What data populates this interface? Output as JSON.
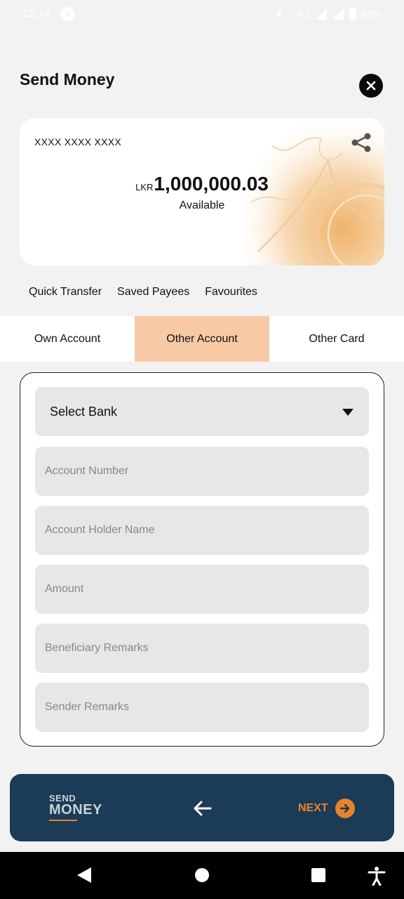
{
  "status_bar": {
    "time": "12:14",
    "app_badge": "A",
    "network": "4G",
    "battery": "80%"
  },
  "header": {
    "title": "Send Money"
  },
  "account_card": {
    "account_number": "XXXX XXXX XXXX",
    "currency": "LKR",
    "balance": "1,000,000.03",
    "balance_caption": "Available"
  },
  "sub_nav": {
    "items": [
      "Quick Transfer",
      "Saved Payees",
      "Favourites"
    ]
  },
  "tabs": [
    {
      "label": "Own Account",
      "active": false
    },
    {
      "label": "Other Account",
      "active": true
    },
    {
      "label": "Other Card",
      "active": false
    }
  ],
  "form": {
    "bank_select": "Select Bank",
    "account_number_placeholder": "Account Number",
    "account_holder_placeholder": "Account Holder Name",
    "amount_placeholder": "Amount",
    "beneficiary_remarks_placeholder": "Beneficiary Remarks",
    "sender_remarks_placeholder": "Sender Remarks"
  },
  "action_bar": {
    "logo_line1": "SEND",
    "logo_line2": "MONEY",
    "next_label": "NEXT"
  },
  "colors": {
    "accent_orange": "#e8832a",
    "active_tab": "#f7caa5",
    "action_bar": "#1c3b56"
  },
  "icons": [
    "close-icon",
    "share-icon",
    "chevron-down-icon",
    "back-arrow-icon",
    "next-arrow-icon"
  ]
}
